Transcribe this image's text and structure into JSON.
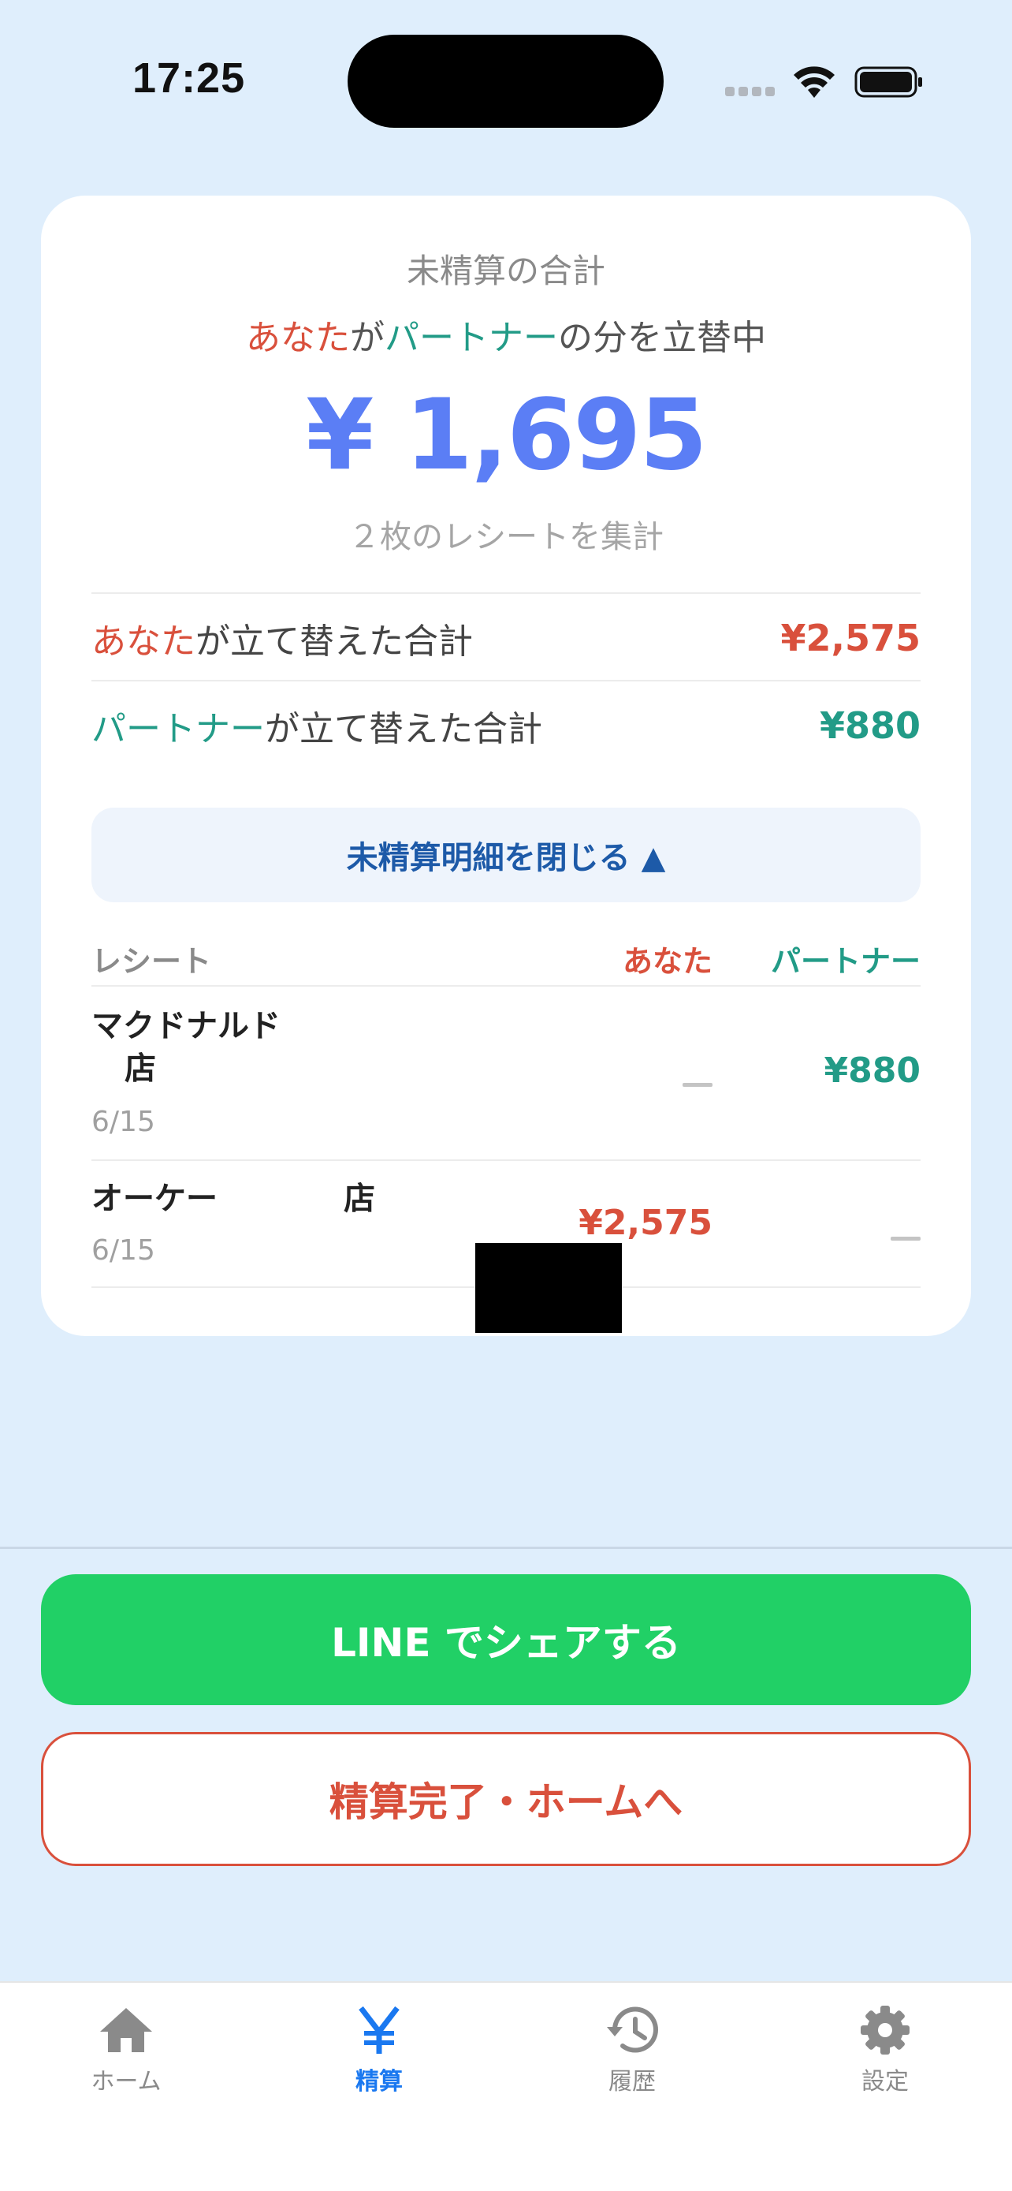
{
  "status": {
    "time": "17:25"
  },
  "summary": {
    "title": "未精算の合計",
    "subtitle_payer": "あなた",
    "subtitle_mid": "が",
    "subtitle_other": "パートナー",
    "subtitle_rest": "の分を立替中",
    "amount": "¥ 1,695",
    "receipt_count": "２枚のレシートを集計"
  },
  "totals": {
    "you_name": "あなた",
    "you_suffix": "が立て替えた合計",
    "you_value": "¥2,575",
    "partner_name": "パートナー",
    "partner_suffix": "が立て替えた合計",
    "partner_value": "¥880"
  },
  "toggle_label": "未精算明細を閉じる ▲",
  "table": {
    "headers": {
      "receipt": "レシート",
      "you": "あなた",
      "partner": "パートナー"
    },
    "rows": [
      {
        "name_line1": "マクドナルド",
        "name_line2": "店",
        "date": "6/15",
        "you": "",
        "partner": "¥880"
      },
      {
        "name_line1": "オーケー　　　　店",
        "date": "6/15",
        "you": "¥2,575",
        "partner": ""
      }
    ]
  },
  "actions": {
    "share": "LINE でシェアする",
    "finish": "精算完了・ホームへ"
  },
  "tabs": [
    {
      "label": "ホーム",
      "icon": "home-icon"
    },
    {
      "label": "精算",
      "icon": "yen-icon"
    },
    {
      "label": "履歴",
      "icon": "history-icon"
    },
    {
      "label": "設定",
      "icon": "gear-icon"
    }
  ],
  "colors": {
    "you": "#d9503c",
    "partner": "#229b87",
    "amount": "#5b7ef5",
    "share": "#21d066",
    "active_tab": "#1a78f0"
  }
}
